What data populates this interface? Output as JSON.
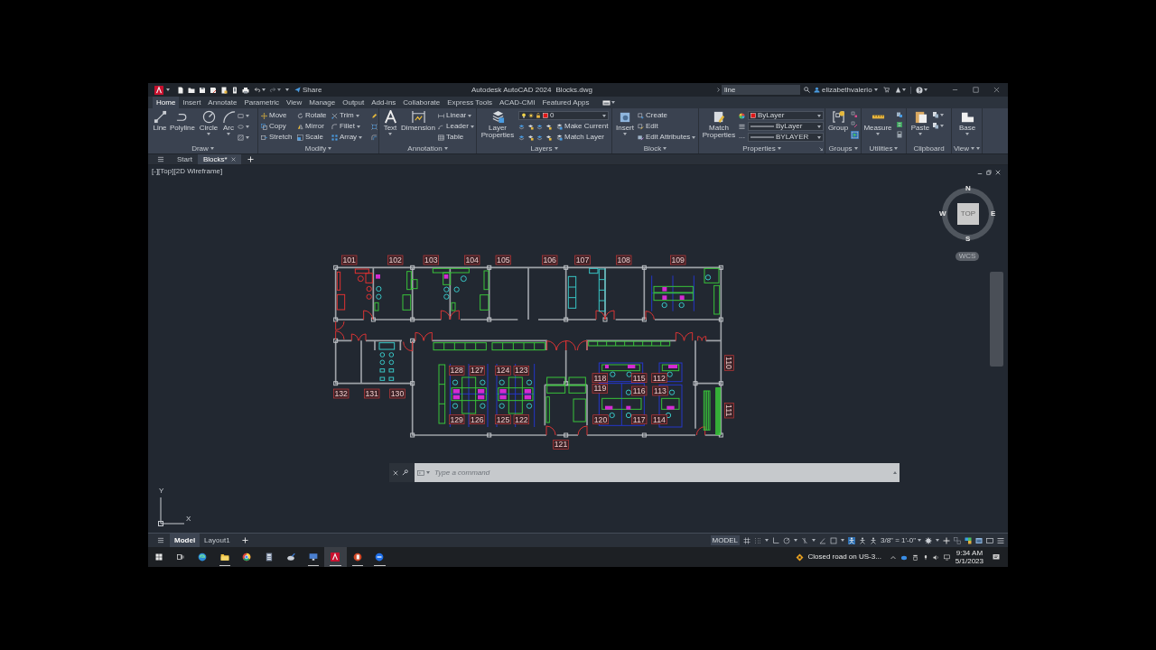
{
  "title_bar": {
    "share": "Share",
    "app_title": "Autodesk AutoCAD 2024",
    "file_name": "Blocks.dwg",
    "search": {
      "value": "line"
    },
    "user": "elizabethvalerio"
  },
  "ribbon_tabs": [
    {
      "label": "Home",
      "selected": true
    },
    {
      "label": "Insert",
      "selected": false
    },
    {
      "label": "Annotate",
      "selected": false
    },
    {
      "label": "Parametric",
      "selected": false
    },
    {
      "label": "View",
      "selected": false
    },
    {
      "label": "Manage",
      "selected": false
    },
    {
      "label": "Output",
      "selected": false
    },
    {
      "label": "Add-ins",
      "selected": false
    },
    {
      "label": "Collaborate",
      "selected": false
    },
    {
      "label": "Express Tools",
      "selected": false
    },
    {
      "label": "ACAD-CMI",
      "selected": false
    },
    {
      "label": "Featured Apps",
      "selected": false
    }
  ],
  "ribbon": {
    "draw": {
      "title": "Draw",
      "tools": [
        "Line",
        "Polyline",
        "Circle",
        "Arc"
      ]
    },
    "modify": {
      "title": "Modify",
      "tools": [
        "Move",
        "Rotate",
        "Trim",
        "Copy",
        "Mirror",
        "Fillet",
        "Stretch",
        "Scale",
        "Array"
      ]
    },
    "annotation": {
      "title": "Annotation",
      "tools": [
        "Text",
        "Dimension"
      ],
      "small_tools": [
        "Linear",
        "Leader",
        "Table"
      ]
    },
    "layers": {
      "title": "Layers",
      "properties": "Layer Properties",
      "current_layer": "0",
      "tools": [
        "Make Current",
        "Match Layer"
      ]
    },
    "block": {
      "title": "Block",
      "insert": "Insert",
      "tools": [
        "Create",
        "Edit",
        "Edit Attributes"
      ]
    },
    "properties": {
      "title": "Properties",
      "match": "Match Properties",
      "color_setting": "ByLayer",
      "lineweight": "ByLayer",
      "linetype": "BYLAYER"
    },
    "groups": {
      "title": "Groups",
      "tool": "Group",
      "selection_on": true
    },
    "utilities": {
      "title": "Utilities",
      "tool": "Measure"
    },
    "clipboard": {
      "title": "Clipboard",
      "tool": "Paste"
    },
    "view": {
      "title": "View",
      "tool": "Base"
    }
  },
  "file_tabs": [
    {
      "label": "Start",
      "selected": false
    },
    {
      "label": "Blocks*",
      "selected": true
    }
  ],
  "viewport": {
    "label": "[-][Top][2D Wireframe]",
    "viewcube": {
      "north": "N",
      "west": "W",
      "face": "TOP",
      "east": "E",
      "south": "S",
      "ucs": "WCS"
    },
    "ucs_icon": {
      "y": "Y",
      "x": "X"
    }
  },
  "floor_plan": {
    "rooms": [
      "101",
      "102",
      "103",
      "104",
      "105",
      "106",
      "107",
      "108",
      "109",
      "110",
      "128",
      "127",
      "124",
      "123",
      "118",
      "115",
      "112",
      "119",
      "116",
      "113",
      "132",
      "131",
      "130",
      "111",
      "129",
      "126",
      "125",
      "122",
      "120",
      "117",
      "114",
      "121"
    ]
  },
  "command_line": {
    "placeholder": "Type a command"
  },
  "layout_tabs": [
    {
      "label": "Model",
      "selected": true
    },
    {
      "label": "Layout1",
      "selected": false
    }
  ],
  "status_bar": {
    "space": "MODEL",
    "toggles": [
      {
        "on": false
      },
      {
        "on": false
      },
      {
        "on": false
      },
      {
        "on": false
      },
      {
        "on": false
      },
      {
        "on": false
      },
      {
        "on": false
      },
      {
        "on": true
      },
      {
        "on": false
      }
    ],
    "annotation_scale": "3/8\" = 1'-0\""
  },
  "taskbar": {
    "apps": [
      {
        "running": false,
        "selected": false
      },
      {
        "running": true,
        "selected": false
      },
      {
        "running": false,
        "selected": false
      },
      {
        "running": false,
        "selected": false
      },
      {
        "running": false,
        "selected": false
      },
      {
        "running": true,
        "selected": false
      },
      {
        "running": true,
        "selected": true
      },
      {
        "running": true,
        "selected": false
      },
      {
        "running": true,
        "selected": false
      }
    ],
    "notification": "Closed road on US-3...",
    "time": "9:34 AM",
    "date": "5/1/2023"
  }
}
